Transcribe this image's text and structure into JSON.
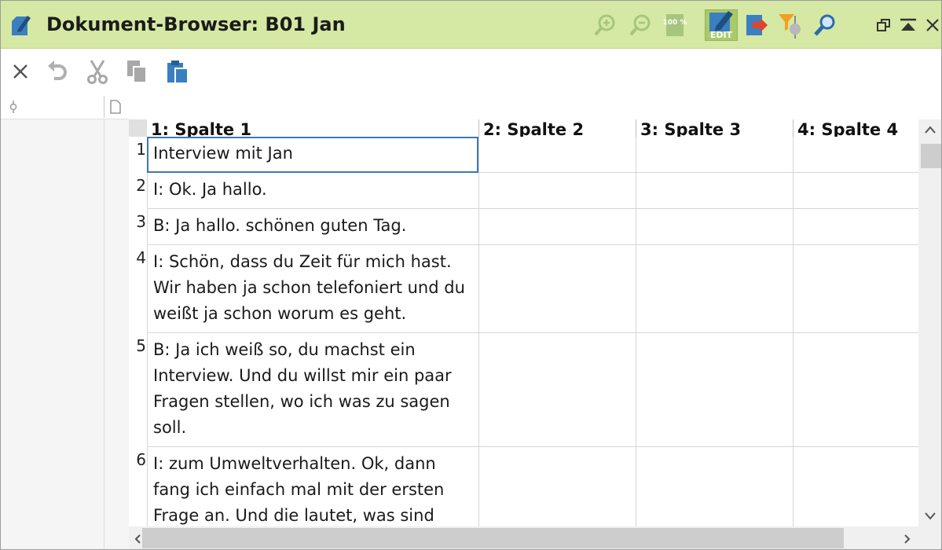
{
  "window": {
    "title": "Dokument-Browser: B01 Jan",
    "edit_label": "EDIT",
    "zoom_100_label": "100 %",
    "accent_color": "#d5e8a4",
    "icons": [
      "document-pen-icon",
      "zoom-in-icon",
      "zoom-out-icon",
      "zoom-100-icon",
      "edit-mode-icon",
      "export-icon",
      "filter-code-icon",
      "search-icon",
      "restore-window-icon",
      "collapse-icon",
      "close-icon"
    ]
  },
  "toolbar": {
    "icons": [
      "close-icon",
      "undo-icon",
      "cut-icon",
      "copy-icon",
      "paste-icon"
    ]
  },
  "grid": {
    "columns": [
      "1: Spalte 1",
      "2: Spalte 2",
      "3: Spalte 3",
      "4: Spalte 4"
    ],
    "rows": [
      {
        "num": "1",
        "cells": [
          "Interview mit Jan",
          "",
          "",
          ""
        ]
      },
      {
        "num": "2",
        "cells": [
          "I: Ok. Ja hallo.",
          "",
          "",
          ""
        ]
      },
      {
        "num": "3",
        "cells": [
          "B: Ja hallo. schönen guten Tag.",
          "",
          "",
          ""
        ]
      },
      {
        "num": "4",
        "cells": [
          "I: Schön, dass du Zeit für mich hast. Wir haben ja schon telefoniert und du weißt ja schon worum es geht.",
          "",
          "",
          ""
        ]
      },
      {
        "num": "5",
        "cells": [
          "B: Ja ich weiß so, du machst ein Interview. Und du willst mir ein paar Fragen stellen, wo ich was zu sagen soll.",
          "",
          "",
          ""
        ]
      },
      {
        "num": "6",
        "cells": [
          "I: zum Umweltverhalten. Ok, dann fang ich einfach mal mit der ersten Frage an. Und die lautet, was sind",
          "",
          "",
          ""
        ]
      }
    ]
  }
}
